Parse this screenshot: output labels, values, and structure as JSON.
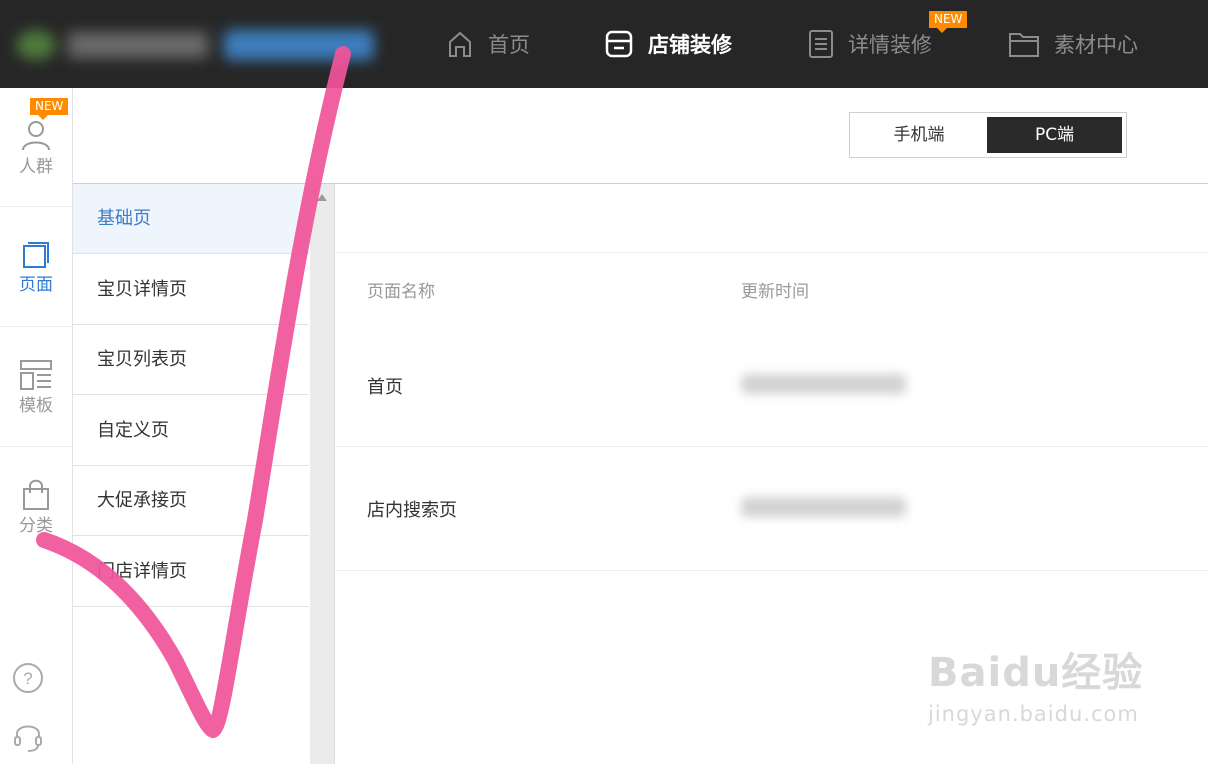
{
  "topnav": {
    "items": [
      {
        "label": "首页",
        "icon": "home-icon",
        "active": false
      },
      {
        "label": "店铺装修",
        "icon": "store-icon",
        "active": true
      },
      {
        "label": "详情装修",
        "icon": "document-icon",
        "active": false,
        "badge": "NEW"
      },
      {
        "label": "素材中心",
        "icon": "folder-icon",
        "active": false
      }
    ]
  },
  "rail": {
    "items": [
      {
        "label": "人群",
        "icon": "user-icon",
        "badge": "NEW"
      },
      {
        "label": "页面",
        "icon": "page-icon",
        "active": true
      },
      {
        "label": "模板",
        "icon": "template-icon"
      },
      {
        "label": "分类",
        "icon": "bag-icon"
      }
    ],
    "bottom_icons": [
      "help-icon",
      "headset-icon"
    ]
  },
  "device_switch": {
    "mobile": "手机端",
    "pc": "PC端",
    "selected": "PC端"
  },
  "page_list": {
    "items": [
      "基础页",
      "宝贝详情页",
      "宝贝列表页",
      "自定义页",
      "大促承接页",
      "门店详情页"
    ],
    "selected": "基础页"
  },
  "table": {
    "columns": [
      "页面名称",
      "更新时间"
    ],
    "rows": [
      {
        "name": "首页"
      },
      {
        "name": "店内搜索页"
      }
    ]
  },
  "watermark": {
    "brand": "Baidu经验",
    "url": "jingyan.baidu.com"
  },
  "colors": {
    "topbar": "#262626",
    "accent_blue": "#2e7bd6",
    "badge_orange": "#ff8a00",
    "annotation_pink": "#f0549a"
  }
}
